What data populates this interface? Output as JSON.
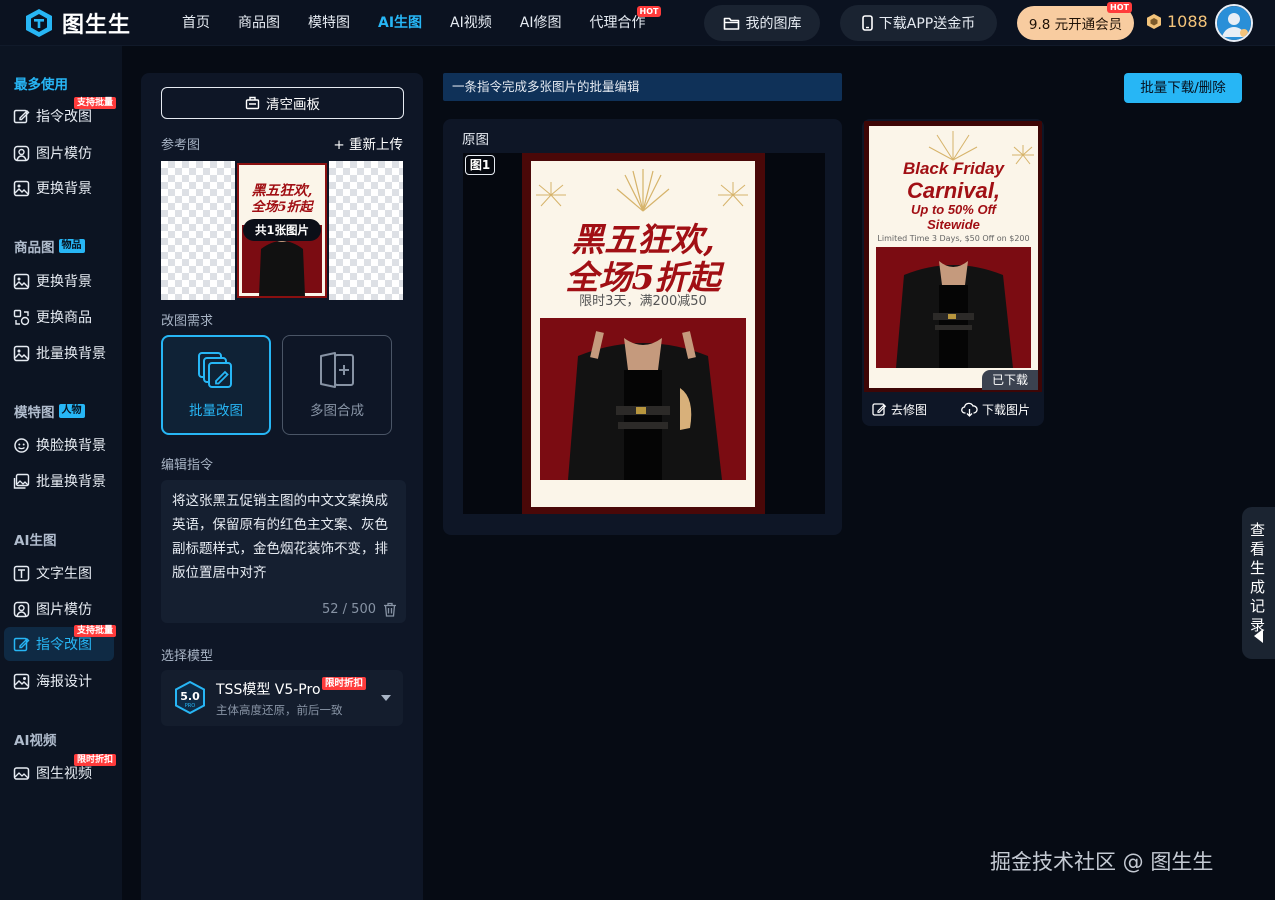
{
  "brand": {
    "name": "图生生"
  },
  "nav": {
    "items": [
      {
        "label": "首页"
      },
      {
        "label": "商品图"
      },
      {
        "label": "模特图"
      },
      {
        "label": "AI生图"
      },
      {
        "label": "AI视频"
      },
      {
        "label": "AI修图"
      },
      {
        "label": "代理合作",
        "badge": "HOT"
      }
    ],
    "gallery_label": "我的图库",
    "download_app_label": "下载APP送金币",
    "vip_label": "9.8 元开通会员",
    "vip_badge": "HOT",
    "coins": "1088"
  },
  "sidebar": {
    "group_frequent": "最多使用",
    "frequent": [
      {
        "label": "指令改图",
        "badge": "支持批量",
        "icon": "edit-icon"
      },
      {
        "label": "图片模仿",
        "icon": "portrait-icon"
      },
      {
        "label": "更换背景",
        "icon": "image-icon"
      }
    ],
    "group_product": "商品图",
    "group_product_tag": "物品",
    "product": [
      {
        "label": "更换背景",
        "icon": "image-icon"
      },
      {
        "label": "更换商品",
        "icon": "swap-icon"
      },
      {
        "label": "批量换背景",
        "icon": "image-icon"
      }
    ],
    "group_model": "模特图",
    "group_model_tag": "人物",
    "model": [
      {
        "label": "换脸换背景",
        "icon": "face-icon"
      },
      {
        "label": "批量换背景",
        "icon": "images-icon"
      }
    ],
    "group_ai": "AI生图",
    "ai": [
      {
        "label": "文字生图",
        "icon": "text-image-icon"
      },
      {
        "label": "图片模仿",
        "icon": "portrait-icon"
      },
      {
        "label": "指令改图",
        "badge": "支持批量",
        "icon": "edit-icon"
      },
      {
        "label": "海报设计",
        "icon": "poster-icon"
      }
    ],
    "group_video": "AI视频",
    "video": [
      {
        "label": "图生视频",
        "badge": "限时折扣",
        "icon": "video-icon"
      }
    ]
  },
  "panel": {
    "clear_button": "清空画板",
    "ref_label": "参考图",
    "reupload_label": "+ 重新上传",
    "ref_count": "共1张图片",
    "mode_label": "改图需求",
    "mode_batch": "批量改图",
    "mode_multi": "多图合成",
    "instruction_label": "编辑指令",
    "instruction_text": "将这张黑五促销主图的中文文案换成英语，保留原有的红色主文案、灰色副标题样式，金色烟花装饰不变，排版位置居中对齐",
    "instruction_counter": "52 / 500",
    "model_label": "选择模型",
    "model_name": "TSS模型 V5-Pro",
    "model_badge": "限时折扣",
    "model_desc": "主体高度还原，前后一致",
    "model_logo_version": "5.0",
    "model_logo_sub": "PRO"
  },
  "banner": {
    "text": "一条指令完成多张图片的批量编辑"
  },
  "batch_button": "批量下载/删除",
  "original": {
    "title": "原图",
    "tag": "图1",
    "poster_line1": "黑五狂欢,",
    "poster_line2": "全场5折起",
    "poster_sub": "限时3天，满200减50"
  },
  "result": {
    "line1": "Black Friday",
    "line2": "Carnival,",
    "line3": "Up to 50% Off",
    "line4": "Sitewide",
    "sub": "Limited Time 3 Days, $50 Off on $200",
    "status": "已下载",
    "retouch_label": "去修图",
    "download_label": "下载图片"
  },
  "history": {
    "label": "查看生成记录"
  },
  "watermark": "掘金技术社区 @ 图生生",
  "colors": {
    "accent": "#27b6f5",
    "hot": "#ff3b3b",
    "vip": "#f8cca0",
    "poster_red": "#a10f14"
  }
}
